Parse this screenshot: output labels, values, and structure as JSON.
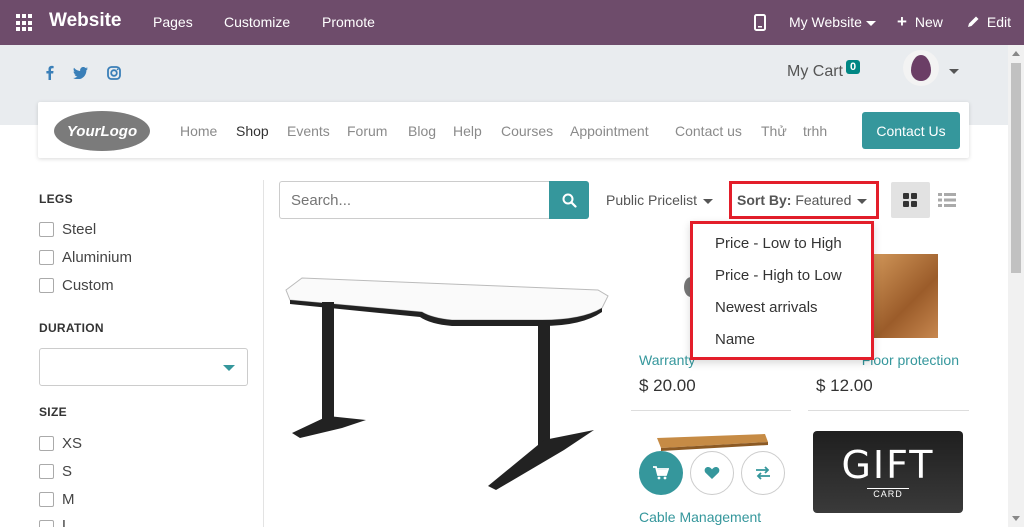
{
  "topbar": {
    "brand": "Website",
    "menu": [
      "Pages",
      "Customize",
      "Promote"
    ],
    "site_switcher": "My Website",
    "new_label": "New",
    "edit_label": "Edit"
  },
  "header": {
    "cart_label": "My Cart",
    "cart_count": "0"
  },
  "navbar": {
    "logo_text": "YourLogo",
    "links": [
      "Home",
      "Shop",
      "Events",
      "Forum",
      "Blog",
      "Help",
      "Courses",
      "Appointment",
      "Contact us",
      "Thử",
      "trhh"
    ],
    "active": "Shop",
    "cta_label": "Contact Us"
  },
  "sidebar": {
    "legs_title": "LEGS",
    "legs_options": [
      "Steel",
      "Aluminium",
      "Custom"
    ],
    "duration_title": "DURATION",
    "size_title": "SIZE",
    "size_options": [
      "XS",
      "S",
      "M",
      "L"
    ]
  },
  "toolbar": {
    "search_placeholder": "Search...",
    "pricelist": "Public Pricelist",
    "sort_label": "Sort By:",
    "sort_value": "Featured"
  },
  "sort_menu": [
    "Price - Low to High",
    "Price - High to Low",
    "Newest arrivals",
    "Name"
  ],
  "products": [
    {
      "name": "Warranty",
      "price": "$ 20.00"
    },
    {
      "name": "Floor protection",
      "price": "$ 12.00"
    },
    {
      "name": "Cable Management",
      "price": ""
    }
  ],
  "gift_card": {
    "big": "GIFT",
    "small": "CARD"
  },
  "colors": {
    "topbar": "#6e4c6b",
    "accent": "#35979c",
    "highlight": "#e31e2a"
  }
}
